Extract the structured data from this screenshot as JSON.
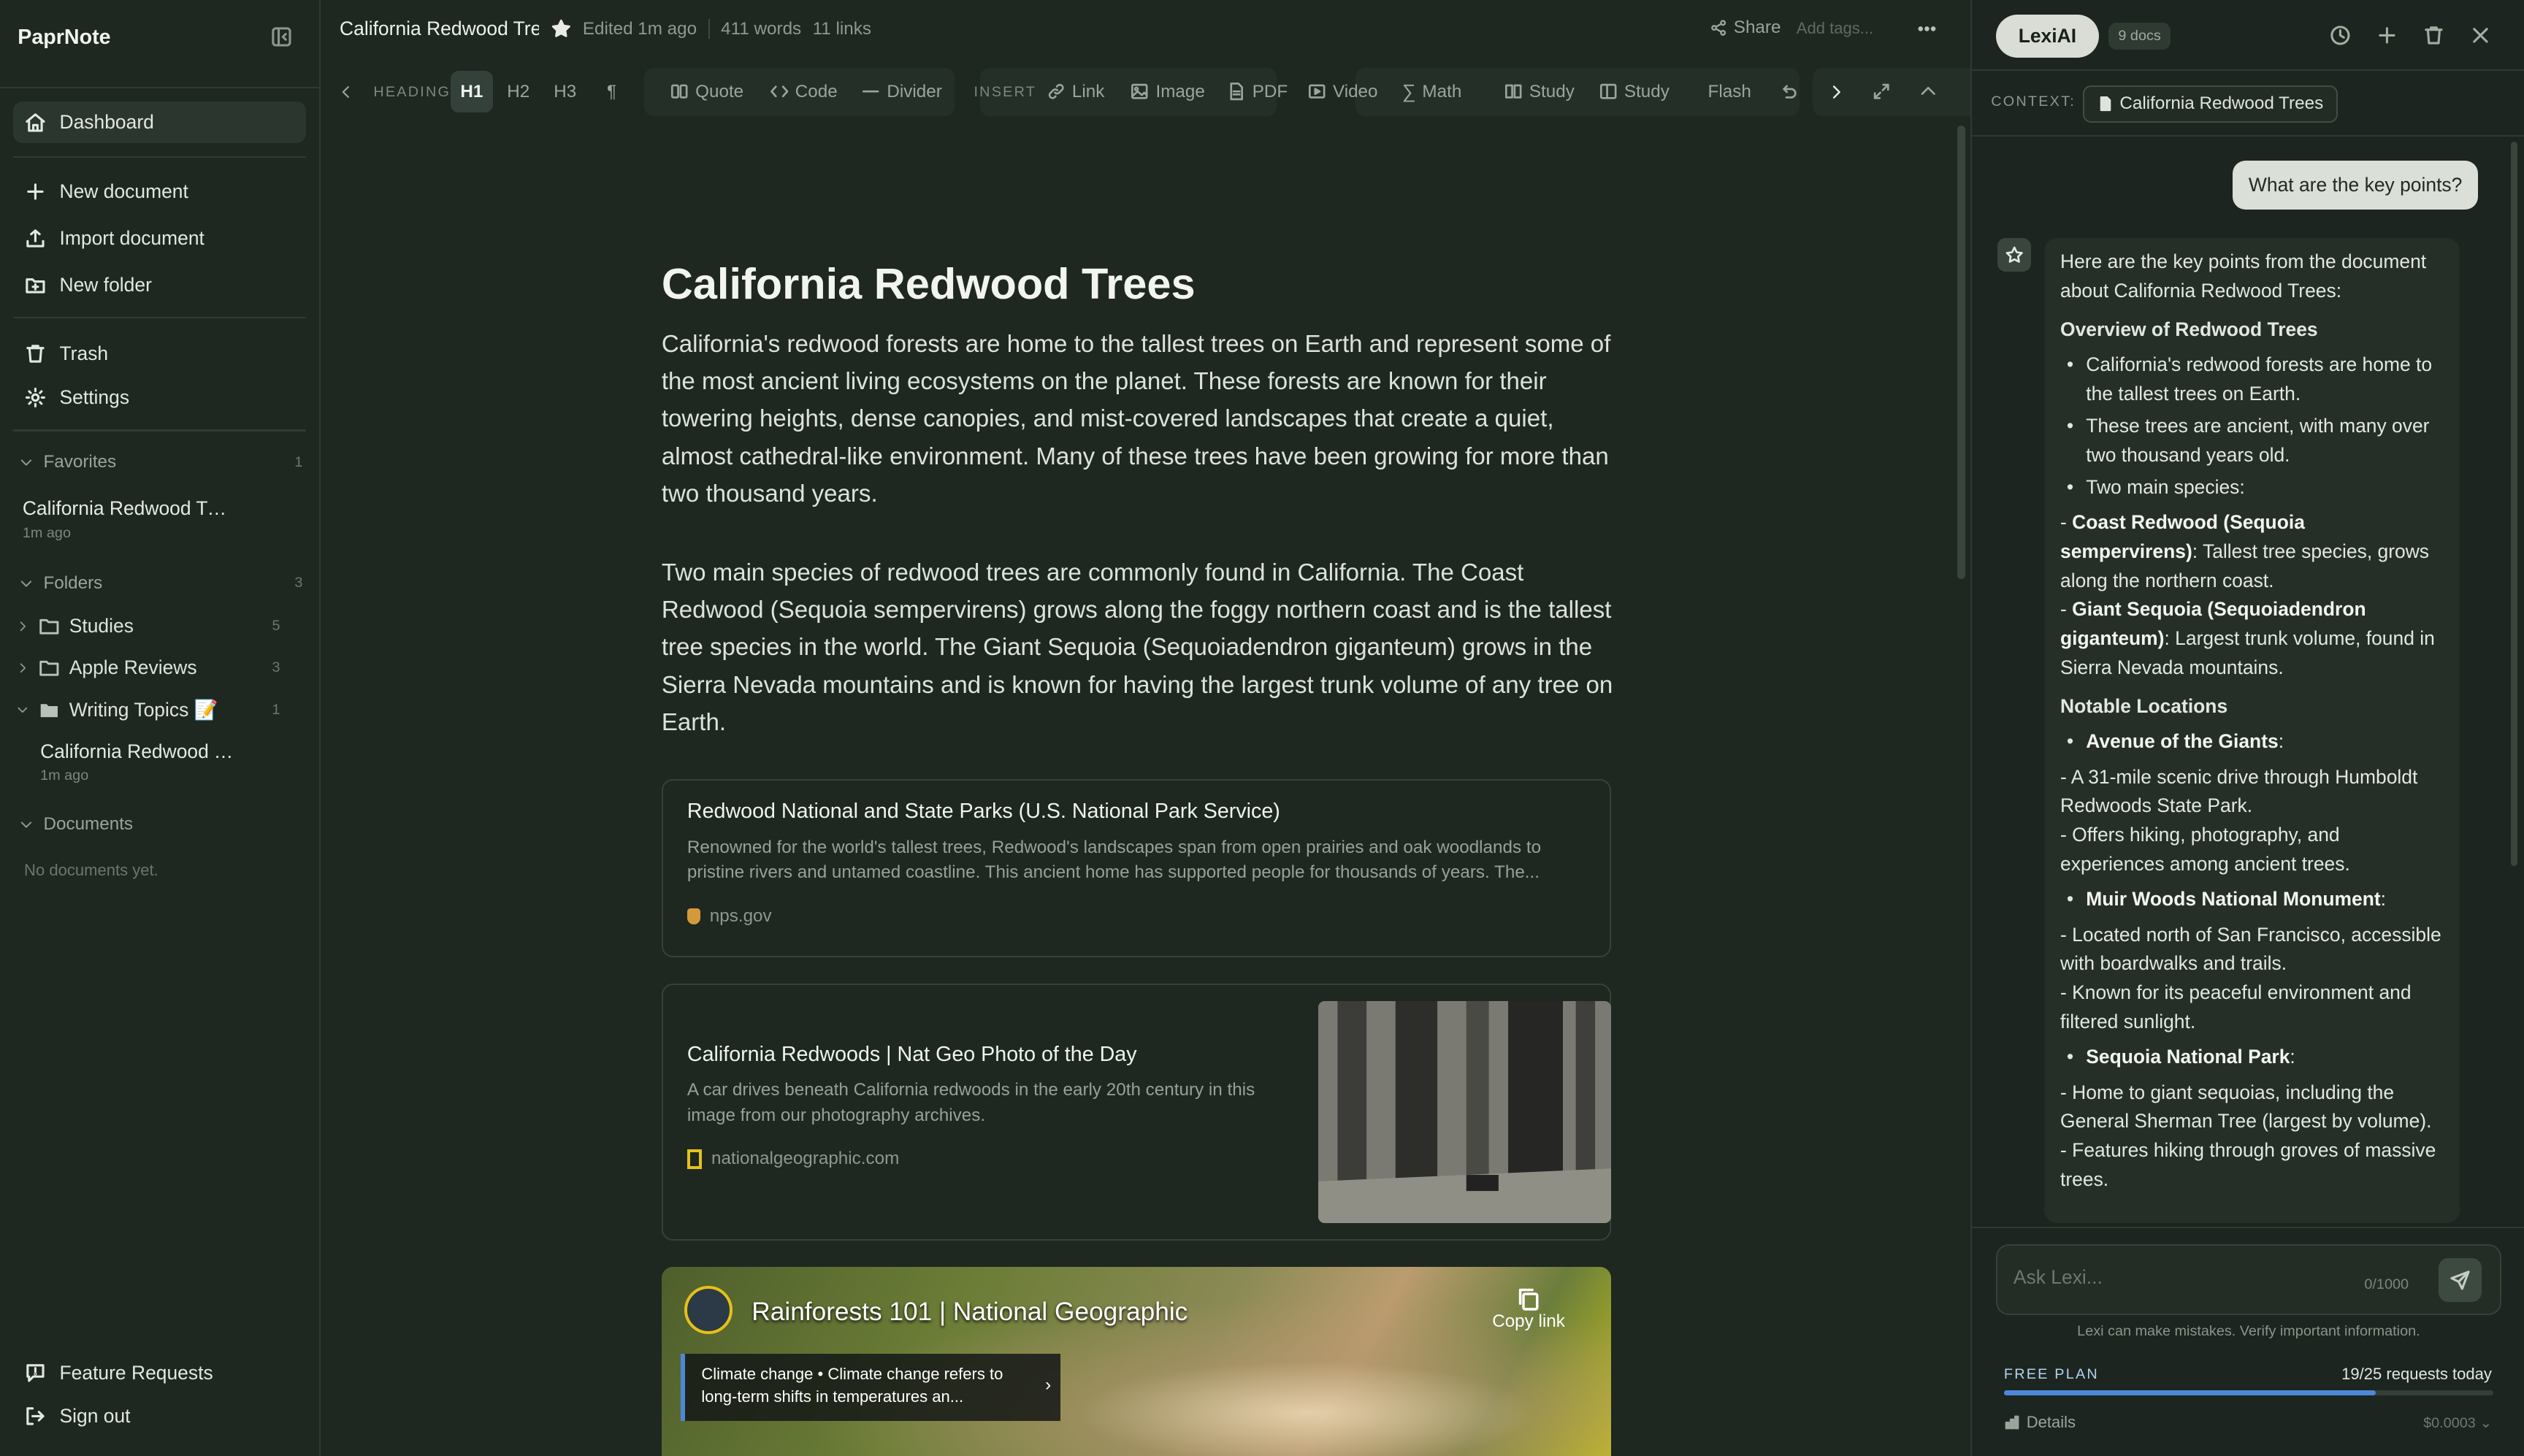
{
  "sidebar": {
    "brand": "PaprNote",
    "nav_dashboard": "Dashboard",
    "nav_new_document": "New document",
    "nav_import": "Import document",
    "nav_new_folder": "New folder",
    "nav_trash": "Trash",
    "nav_settings": "Settings",
    "favorites": {
      "label": "Favorites",
      "count": "1",
      "item_title": "California Redwood Tre...",
      "item_time": "1m ago"
    },
    "folders": {
      "label": "Folders",
      "count": "3",
      "items": [
        {
          "name": "Studies",
          "count": "5"
        },
        {
          "name": "Apple Reviews",
          "count": "3"
        },
        {
          "name": "Writing Topics 📝",
          "count": "1"
        }
      ],
      "child_title": "California Redwood T...",
      "child_time": "1m ago"
    },
    "documents": {
      "label": "Documents",
      "empty": "No documents yet."
    },
    "feature_requests": "Feature Requests",
    "sign_out": "Sign out"
  },
  "editor": {
    "doc_title_short": "California Redwood Tre",
    "edited": "Edited 1m ago",
    "words": "411 words",
    "links": "11 links",
    "share": "Share",
    "add_tags": "Add tags...",
    "toolbar": {
      "heading_label": "HEADING",
      "h1": "H1",
      "h2": "H2",
      "h3": "H3",
      "para": "¶",
      "quote": "Quote",
      "code": "Code",
      "divider": "Divider",
      "insert_label": "INSERT",
      "link": "Link",
      "image": "Image",
      "pdf": "PDF",
      "video": "Video",
      "math": "Math",
      "study1": "Study",
      "study2": "Study",
      "flash": "Flash"
    },
    "title": "California Redwood Trees",
    "paragraph1": "California's redwood forests are home to the tallest trees on Earth and represent some of the most ancient living ecosystems on the planet. These forests are known for their towering heights, dense canopies, and mist-covered landscapes that create a quiet, almost cathedral-like environment. Many of these trees have been growing for more than two thousand years.",
    "paragraph2": "Two main species of redwood trees are commonly found in California. The Coast Redwood (Sequoia sempervirens) grows along the foggy northern coast and is the tallest tree species in the world. The Giant Sequoia (Sequoiadendron giganteum) grows in the Sierra Nevada mountains and is known for having the largest trunk volume of any tree on Earth.",
    "card1": {
      "title": "Redwood National and State Parks (U.S. National Park Service)",
      "desc": "Renowned for the world's tallest trees, Redwood's landscapes span from open prairies and oak woodlands to pristine rivers and untamed coastline. This ancient home has supported people for thousands of years. The...",
      "site": "nps.gov"
    },
    "card2": {
      "title": "California Redwoods | Nat Geo Photo of the Day",
      "desc": "A car drives beneath California redwoods in the early 20th century in this image from our photography archives.",
      "site": "nationalgeographic.com"
    },
    "video": {
      "title": "Rainforests 101 | National Geographic",
      "copy": "Copy link",
      "chip": "Climate change • Climate change refers to long-term shifts in temperatures an..."
    }
  },
  "ai": {
    "tab": "LexiAI",
    "docs": "9 docs",
    "context_label": "CONTEXT:",
    "context_doc": "California Redwood Trees",
    "user_message": "What are the key points?",
    "reply": {
      "intro": "Here are the key points from the document about California Redwood Trees:",
      "h_overview": "Overview of Redwood Trees",
      "b1": "California's redwood forests are home to the tallest trees on Earth.",
      "b2": "These trees are ancient, with many over two thousand years old.",
      "b3": "Two main species:",
      "coast_name": "Coast Redwood (Sequoia sempervirens)",
      "coast_desc": ": Tallest tree species, grows along the northern coast.",
      "giant_name": "Giant Sequoia (Sequoiadendron giganteum)",
      "giant_desc": ": Largest trunk volume, found in Sierra Nevada mountains.",
      "h_locations": "Notable Locations",
      "avenue": "Avenue of the Giants",
      "avenue_d1": "- A 31-mile scenic drive through Humboldt Redwoods State Park.",
      "avenue_d2": "- Offers hiking, photography, and experiences among ancient trees.",
      "muir": "Muir Woods National Monument",
      "muir_d1": "- Located north of San Francisco, accessible with boardwalks and trails.",
      "muir_d2": "- Known for its peaceful environment and filtered sunlight.",
      "sequoia": "Sequoia National Park",
      "sequoia_d1": "- Home to giant sequoias, including the General Sherman Tree (largest by volume).",
      "sequoia_d2": "- Features hiking through groves of massive trees."
    },
    "input_placeholder": "Ask Lexi...",
    "char_count": "0/1000",
    "disclaimer": "Lexi can make mistakes. Verify important information.",
    "plan_label": "FREE PLAN",
    "requests": "19/25 requests today",
    "usage_fraction": 0.76,
    "details": "Details",
    "cost": "$0.0003"
  },
  "colors": {
    "accent": "#4d88d6",
    "background": "#1e2820",
    "panel": "#1c251f"
  }
}
